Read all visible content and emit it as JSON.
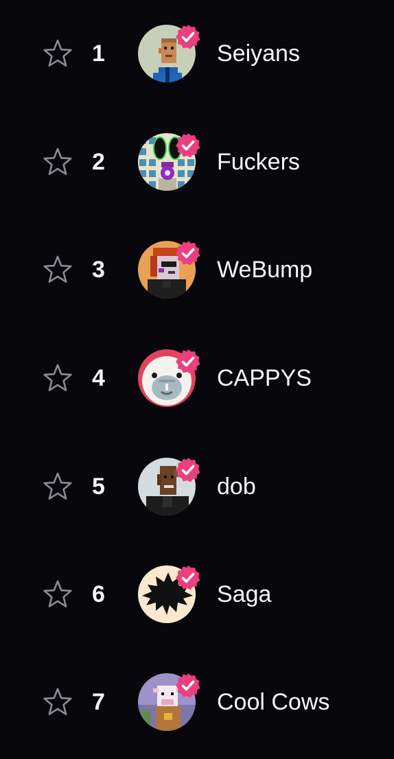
{
  "collections": [
    {
      "rank": "1",
      "name": "Seiyans",
      "avatar": "seiyans-avatar"
    },
    {
      "rank": "2",
      "name": "Fuckers",
      "avatar": "fuckers-avatar"
    },
    {
      "rank": "3",
      "name": "WeBump",
      "avatar": "webump-avatar"
    },
    {
      "rank": "4",
      "name": "CAPPYS",
      "avatar": "cappys-avatar"
    },
    {
      "rank": "5",
      "name": "dob",
      "avatar": "dob-avatar"
    },
    {
      "rank": "6",
      "name": "Saga",
      "avatar": "saga-avatar"
    },
    {
      "rank": "7",
      "name": "Cool Cows",
      "avatar": "cool-cows-avatar"
    }
  ],
  "icons": {
    "favorite": "star-outline-icon",
    "verified": "verified-badge-icon"
  },
  "colors": {
    "background": "#08070b",
    "verified_badge": "#ec3f7d",
    "star_outline": "#8d8c93",
    "text": "#f5f5f7"
  }
}
